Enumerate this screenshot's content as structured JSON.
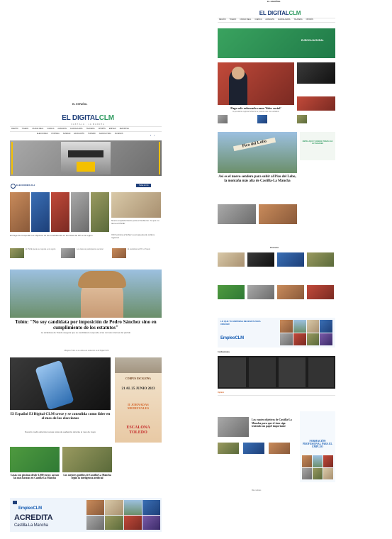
{
  "left": {
    "brand_top": "EL ESPAÑOL",
    "logo_main": "EL DIGITAL",
    "logo_clm": "CLM",
    "logo_sub": "CASTILLA · LA MANCHA",
    "nav": [
      "Región",
      "Toledo",
      "Ciudad Real",
      "Cuenca",
      "Albacete",
      "Guadalajara",
      "Talavera",
      "Opinión",
      "Empleo",
      "Deportes"
    ],
    "sub_nav": [
      "Elecciones",
      "Portada",
      "Sanidad",
      "Educación",
      "Turismo",
      "Agricultura",
      "Sucesos"
    ],
    "section_label": "ELECCIONES 23-J",
    "section_button": "Todas la info",
    "story1_caption": "El Page-De Cospedal: los objetivos de las candidaturas en las listas del PP en la región",
    "story2_caption": "Nuevo emplazamiento para el Gobierno: 'lo que no tiene el PSOE'",
    "story3_caption": "VOX elimina a Núñez su propuesta de cultura regional",
    "small_stories": [
      "El PSOE pierde su mayoría en la región",
      "Los datos de participación electoral",
      "El candidato del PP en Toledo"
    ],
    "main_headline": "Tolón: \"No soy candidata por imposición de Pedro Sánchez sino en cumplimiento de los estatutos\"",
    "main_deck": "La alcaldesa de Toledo asegura que su candidatura responde a las normas internas del partido",
    "main_caption": "Milagros Tolón en su visita a la redacción de El Digital CLM",
    "feature_headline": "El Español El Digital CLM crece y se consolida como líder en el mes de las elecciones",
    "feature_deck": "Nuestro medio alcanza nuevas cotas de audiencia durante el mes de mayo",
    "ad_corpus": "CORPUS ESCALONA",
    "ad_dates": "21 AL 25 JUNIO 2023",
    "ad_jornadas": "II JORNADAS MEDIEVALES",
    "ad_town": "ESCALONA TOLEDO",
    "bottom_story1": "Casas con piscinas desde 1.000 euros: así son las más baratas en Castilla-La Mancha",
    "bottom_story2": "Los mejores pueblos de Castilla-La Mancha según la inteligencia artificial",
    "footer_ad_brand": "EmpleoCLM",
    "footer_ad_action": "ACREDITA",
    "footer_ad_region": "Castilla-La Mancha"
  },
  "right": {
    "brand_top": "EL ESPAÑOL",
    "logo_main": "EL DIGITAL",
    "logo_clm": "CLM",
    "ad_label": "EUROCAJA RURAL",
    "story_headline": "Page sale reforzado como 'líder social'",
    "story_deck": "El presidente regional refuerza su posición tras los resultados",
    "pico_headline": "Así es el nuevo sendero para subir al Pico del Lobo, la montaña más alta de Castilla-La Mancha",
    "pico_sign": "Pico del Lobo",
    "side_ad": "ENTRA AQUÍ Y CONOCE TODAS LAS ACTIVIDADES",
    "section_label": "Provincias",
    "empleo_banner": "LO QUE TU EMPRESA NECESITA PARA CRECER",
    "empleo_brand": "EmpleoCLM",
    "dark_section": "Confidenciales",
    "opinion_label": "Opinión",
    "lower_headline": "Los cuatro objetivos de Castilla-La Mancha para que el vino siga teniendo un papel importante",
    "side_ad2_title": "FORMACIÓN PROFESIONAL PARA EL EMPLEO",
    "footer_note": "Más noticias"
  },
  "colors": {
    "brand_blue": "#1f3f7a",
    "accent_green": "#2e9a5f",
    "empleo_blue": "#1a5fb4",
    "ad_orange": "#d4662b"
  }
}
